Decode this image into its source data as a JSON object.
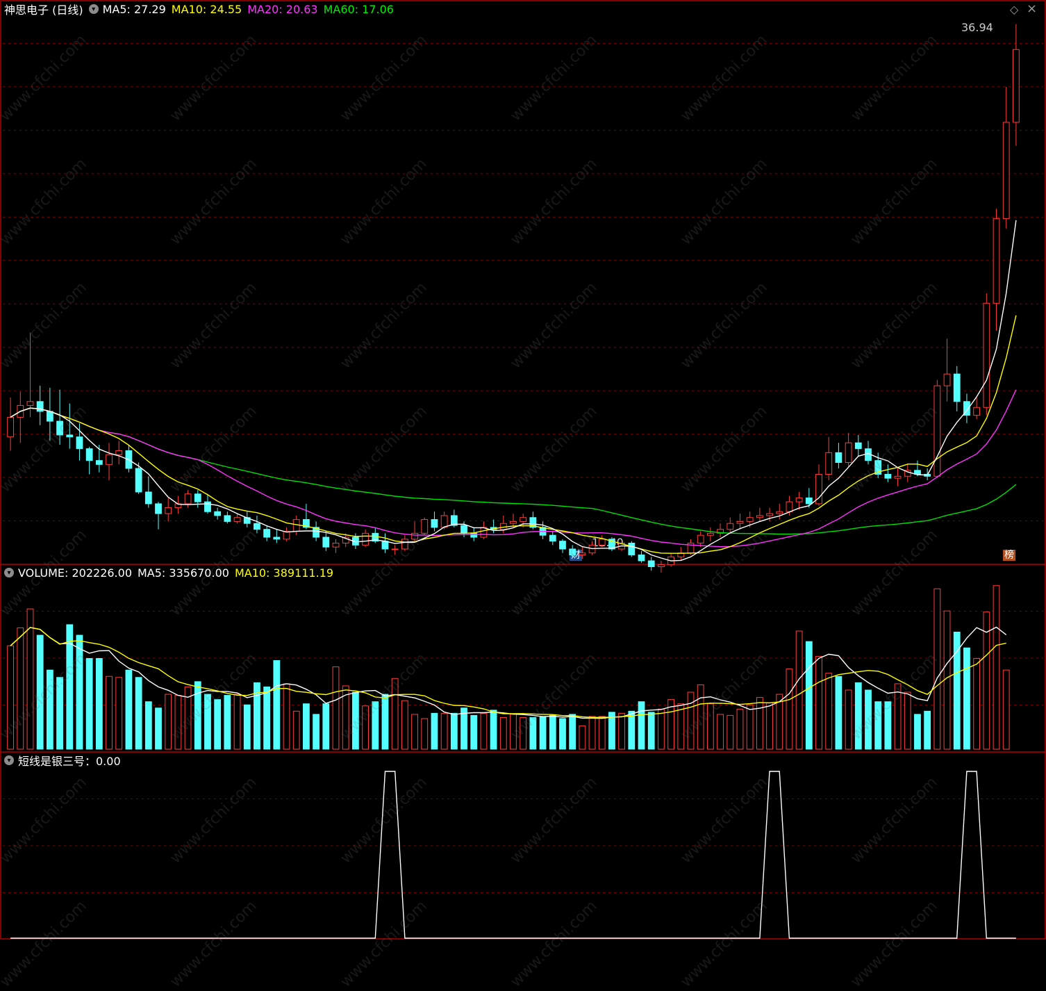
{
  "main_legend": {
    "title": "神思电子 (日线)",
    "items": [
      {
        "label": "MA5: 27.29",
        "color": "#ffffff"
      },
      {
        "label": "MA10: 24.55",
        "color": "#ffff00"
      },
      {
        "label": "MA20: 20.63",
        "color": "#ff33ff"
      },
      {
        "label": "MA60: 17.06",
        "color": "#00e000"
      }
    ]
  },
  "annotations": {
    "high_label": "36.94",
    "low_label": "12.40",
    "finance_badge": "财",
    "rank_badge": "榜",
    "diamond_icon": "diamond-icon"
  },
  "volume_legend": {
    "items": [
      {
        "label": "VOLUME: 202226.00",
        "color": "#ffffff"
      },
      {
        "label": "MA5: 335670.00",
        "color": "#ffffff"
      },
      {
        "label": "MA10: 389111.19",
        "color": "#ffff00"
      }
    ]
  },
  "indicator_legend": {
    "items": [
      {
        "label": "短线是银三号：0.00",
        "color": "#ffffff"
      }
    ]
  },
  "watermark": "www.cfchi.com",
  "colors": {
    "up": "#ff3c3c",
    "down": "#54ffff",
    "grid": "#7a0000",
    "border": "#b00000",
    "ma5": "#ffffff",
    "ma10": "#ffff00",
    "ma20": "#ff33ff",
    "ma60": "#00e000"
  },
  "chart_data": [
    {
      "type": "candlestick",
      "title": "神思电子 (日线)",
      "ylim": [
        11.5,
        38.5
      ],
      "ohlc": [
        [
          17.2,
          19.2,
          16.5,
          18.2
        ],
        [
          18.2,
          19.5,
          16.9,
          18.8
        ],
        [
          18.8,
          22.5,
          18.2,
          19.0
        ],
        [
          19.0,
          19.8,
          17.8,
          18.5
        ],
        [
          18.5,
          19.7,
          17.0,
          18.0
        ],
        [
          18.0,
          19.6,
          16.8,
          17.3
        ],
        [
          17.3,
          18.9,
          16.6,
          17.2
        ],
        [
          17.2,
          17.9,
          16.0,
          16.6
        ],
        [
          16.6,
          16.7,
          15.3,
          16.0
        ],
        [
          16.0,
          16.8,
          15.4,
          15.8
        ],
        [
          15.8,
          16.9,
          15.0,
          16.3
        ],
        [
          16.3,
          17.0,
          15.8,
          16.5
        ],
        [
          16.5,
          16.8,
          15.4,
          15.6
        ],
        [
          15.6,
          15.9,
          14.3,
          14.4
        ],
        [
          14.4,
          15.2,
          13.6,
          13.8
        ],
        [
          13.8,
          13.9,
          12.5,
          13.3
        ],
        [
          13.3,
          14.1,
          12.9,
          13.6
        ],
        [
          13.6,
          14.2,
          13.3,
          13.8
        ],
        [
          13.8,
          14.5,
          13.6,
          14.3
        ],
        [
          14.3,
          14.5,
          13.6,
          13.9
        ],
        [
          13.9,
          14.3,
          13.3,
          13.4
        ],
        [
          13.4,
          13.6,
          13.0,
          13.2
        ],
        [
          13.2,
          13.4,
          12.8,
          12.9
        ],
        [
          12.9,
          13.3,
          12.8,
          13.1
        ],
        [
          13.1,
          13.4,
          12.6,
          12.8
        ],
        [
          12.8,
          13.2,
          12.3,
          12.5
        ],
        [
          12.5,
          12.7,
          11.9,
          12.1
        ],
        [
          12.1,
          12.5,
          11.8,
          12.0
        ],
        [
          12.0,
          12.6,
          11.9,
          12.4
        ],
        [
          12.4,
          13.2,
          12.2,
          13.0
        ],
        [
          13.0,
          13.8,
          12.5,
          12.6
        ],
        [
          12.6,
          12.9,
          11.9,
          12.1
        ],
        [
          12.1,
          12.4,
          11.4,
          11.6
        ],
        [
          11.6,
          12.0,
          11.3,
          11.8
        ],
        [
          11.8,
          12.3,
          11.6,
          12.1
        ],
        [
          12.1,
          12.3,
          11.5,
          11.7
        ],
        [
          11.7,
          12.5,
          11.6,
          12.3
        ],
        [
          12.3,
          12.6,
          11.8,
          11.9
        ],
        [
          11.9,
          12.3,
          11.3,
          11.5
        ],
        [
          11.5,
          11.7,
          11.2,
          11.5
        ],
        [
          11.5,
          12.2,
          11.4,
          12.0
        ],
        [
          12.0,
          12.9,
          11.9,
          12.3
        ],
        [
          12.3,
          13.1,
          12.2,
          13.0
        ],
        [
          13.0,
          13.4,
          12.4,
          12.6
        ],
        [
          12.6,
          13.4,
          12.5,
          13.2
        ],
        [
          13.2,
          13.5,
          12.6,
          12.7
        ],
        [
          12.7,
          12.9,
          12.1,
          12.3
        ],
        [
          12.3,
          12.6,
          11.9,
          12.1
        ],
        [
          12.1,
          12.9,
          12.0,
          12.6
        ],
        [
          12.6,
          13.0,
          12.3,
          12.5
        ],
        [
          12.5,
          13.2,
          12.3,
          12.8
        ],
        [
          12.8,
          13.3,
          12.6,
          12.9
        ],
        [
          12.9,
          13.3,
          12.6,
          13.1
        ],
        [
          13.1,
          13.4,
          12.5,
          12.6
        ],
        [
          12.6,
          12.9,
          12.0,
          12.2
        ],
        [
          12.2,
          12.4,
          11.7,
          11.9
        ],
        [
          11.9,
          12.0,
          11.3,
          11.5
        ],
        [
          11.5,
          11.7,
          11.1,
          11.2
        ],
        [
          11.2,
          11.6,
          11.0,
          11.3
        ],
        [
          11.3,
          11.9,
          11.2,
          11.7
        ],
        [
          11.7,
          12.2,
          11.6,
          12.0
        ],
        [
          12.0,
          12.1,
          11.4,
          11.5
        ],
        [
          11.5,
          11.9,
          11.4,
          11.8
        ],
        [
          11.8,
          11.9,
          11.1,
          11.2
        ],
        [
          11.2,
          11.4,
          10.8,
          10.9
        ],
        [
          10.9,
          11.1,
          10.4,
          10.6
        ],
        [
          10.6,
          10.9,
          10.3,
          10.7
        ],
        [
          10.7,
          11.3,
          10.6,
          11.1
        ],
        [
          11.1,
          11.6,
          10.9,
          11.3
        ],
        [
          11.3,
          12.0,
          11.2,
          11.8
        ],
        [
          11.8,
          12.4,
          11.6,
          12.2
        ],
        [
          12.2,
          12.6,
          11.9,
          12.3
        ],
        [
          12.3,
          12.8,
          12.1,
          12.5
        ],
        [
          12.5,
          13.1,
          12.3,
          12.8
        ],
        [
          12.8,
          13.3,
          12.5,
          12.9
        ],
        [
          12.9,
          13.4,
          12.6,
          13.1
        ],
        [
          13.1,
          13.6,
          12.9,
          13.2
        ],
        [
          13.2,
          13.6,
          12.9,
          13.3
        ],
        [
          13.3,
          13.8,
          13.0,
          13.4
        ],
        [
          13.4,
          14.2,
          13.2,
          13.9
        ],
        [
          13.9,
          14.4,
          13.5,
          14.1
        ],
        [
          14.1,
          14.6,
          13.6,
          13.8
        ],
        [
          13.8,
          15.8,
          13.7,
          15.3
        ],
        [
          15.3,
          17.2,
          15.0,
          16.4
        ],
        [
          16.4,
          16.9,
          15.6,
          15.9
        ],
        [
          15.9,
          17.4,
          15.7,
          16.9
        ],
        [
          16.9,
          17.3,
          16.2,
          16.6
        ],
        [
          16.6,
          17.0,
          15.8,
          16.0
        ],
        [
          16.0,
          16.4,
          15.1,
          15.3
        ],
        [
          15.3,
          15.8,
          14.9,
          15.1
        ],
        [
          15.1,
          15.6,
          14.7,
          15.2
        ],
        [
          15.2,
          15.8,
          14.9,
          15.5
        ],
        [
          15.5,
          16.0,
          15.2,
          15.3
        ],
        [
          15.3,
          15.6,
          15.0,
          15.2
        ],
        [
          15.2,
          20.1,
          15.1,
          19.8
        ],
        [
          19.8,
          22.2,
          19.0,
          20.4
        ],
        [
          20.4,
          20.8,
          18.5,
          19.0
        ],
        [
          19.0,
          19.4,
          17.9,
          18.3
        ],
        [
          18.3,
          19.2,
          18.1,
          18.7
        ],
        [
          18.7,
          24.5,
          18.3,
          24.0
        ],
        [
          24.0,
          28.8,
          22.6,
          28.3
        ],
        [
          28.3,
          35.0,
          27.8,
          33.2
        ],
        [
          33.2,
          38.2,
          32.0,
          36.9
        ]
      ],
      "note": "ohlc values are approximate relative price points read from the chart (up to 12.40 low and 36.94 high)"
    },
    {
      "type": "bar",
      "title": "VOLUME",
      "values": [
        980,
        1150,
        1330,
        1080,
        750,
        680,
        1180,
        1080,
        860,
        860,
        690,
        680,
        750,
        680,
        450,
        390,
        520,
        510,
        590,
        640,
        520,
        470,
        510,
        520,
        420,
        630,
        590,
        840,
        620,
        360,
        430,
        330,
        430,
        780,
        600,
        540,
        410,
        450,
        520,
        670,
        460,
        330,
        290,
        340,
        340,
        340,
        390,
        320,
        340,
        370,
        300,
        330,
        300,
        300,
        310,
        320,
        290,
        330,
        220,
        310,
        310,
        350,
        340,
        360,
        450,
        350,
        380,
        470,
        430,
        540,
        610,
        430,
        330,
        320,
        380,
        420,
        490,
        440,
        520,
        760,
        1120,
        1020,
        880,
        720,
        690,
        560,
        630,
        560,
        450,
        450,
        620,
        540,
        330,
        360,
        1520,
        1310,
        1110,
        960,
        860,
        1300,
        1550,
        750
      ]
    },
    {
      "type": "line",
      "title": "短线是银三号",
      "values": [
        0,
        0,
        0,
        0,
        0,
        0,
        0,
        0,
        0,
        0,
        0,
        0,
        0,
        0,
        0,
        0,
        0,
        0,
        0,
        0,
        0,
        0,
        0,
        0,
        0,
        0,
        0,
        0,
        0,
        0,
        0,
        0,
        0,
        0,
        0,
        0,
        0,
        0,
        1,
        1,
        0,
        0,
        0,
        0,
        0,
        0,
        0,
        0,
        0,
        0,
        0,
        0,
        0,
        0,
        0,
        0,
        0,
        0,
        0,
        0,
        0,
        0,
        0,
        0,
        0,
        0,
        0,
        0,
        0,
        0,
        0,
        0,
        0,
        0,
        0,
        0,
        0,
        1,
        1,
        0,
        0,
        0,
        0,
        0,
        0,
        0,
        0,
        0,
        0,
        0,
        0,
        0,
        0,
        0,
        0,
        0,
        0,
        1,
        1,
        0,
        0,
        0,
        0
      ]
    }
  ]
}
